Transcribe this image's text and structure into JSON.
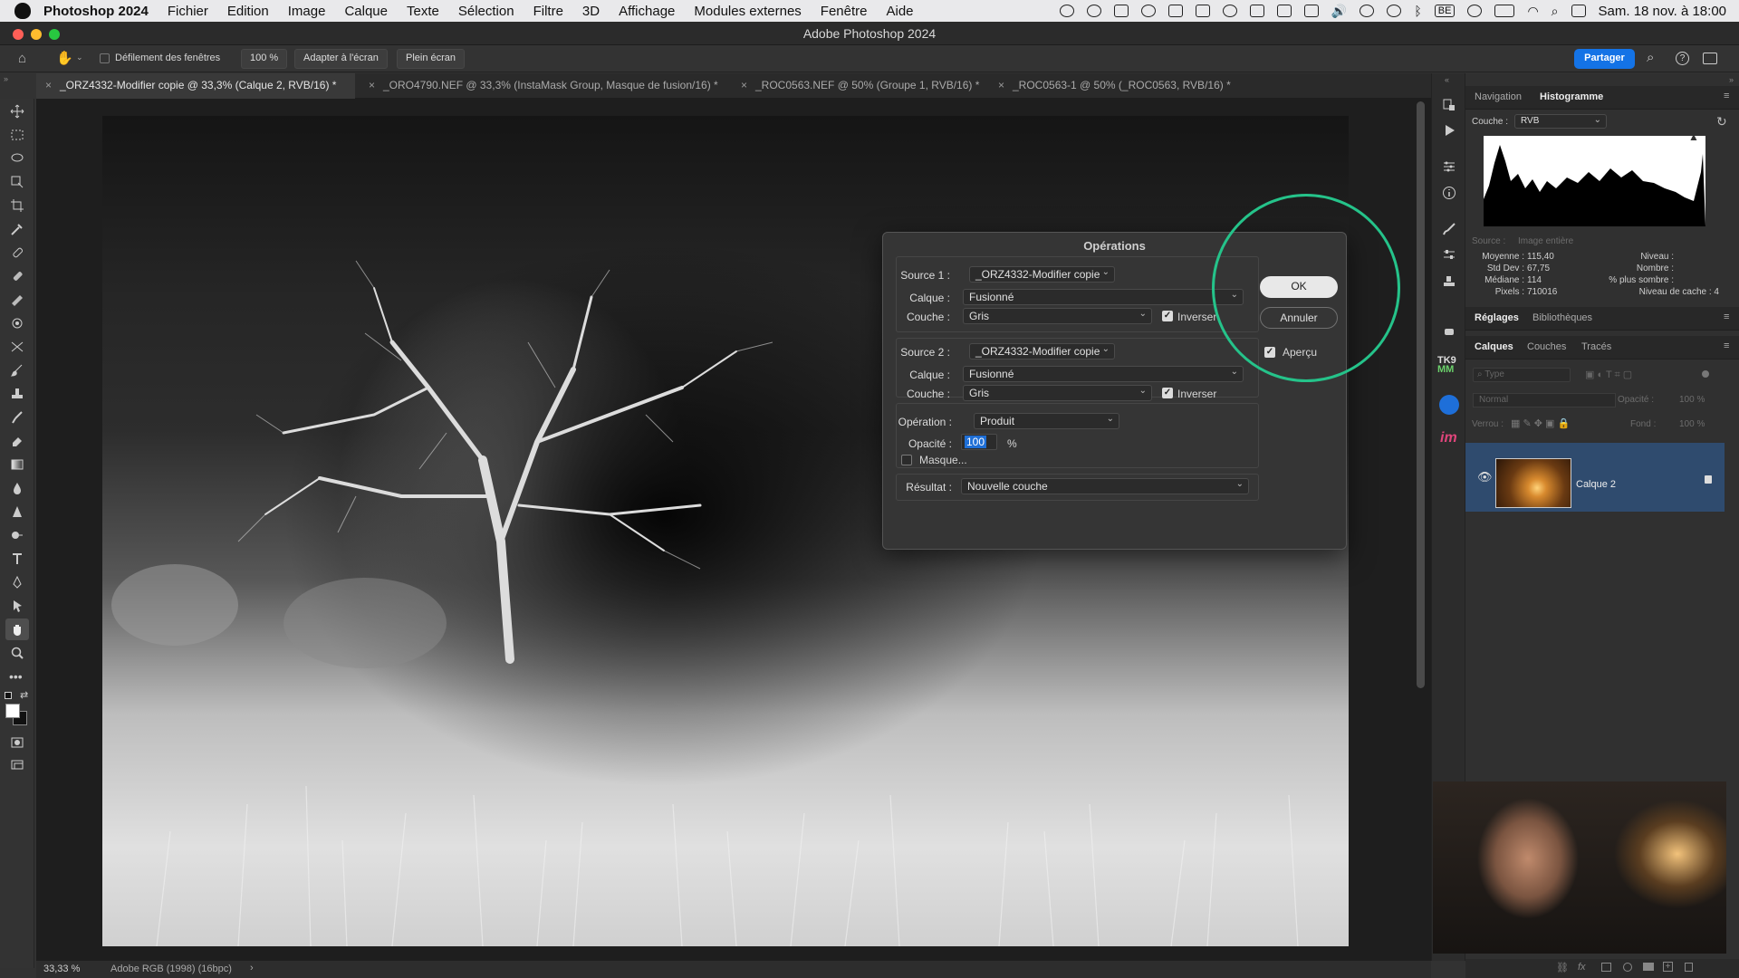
{
  "menubar": {
    "app": "Photoshop 2024",
    "items": [
      "Fichier",
      "Edition",
      "Image",
      "Calque",
      "Texte",
      "Sélection",
      "Filtre",
      "3D",
      "Affichage",
      "Modules externes",
      "Fenêtre",
      "Aide"
    ],
    "lang_badge": "BE",
    "datetime": "Sam. 18 nov. à 18:00"
  },
  "window": {
    "title": "Adobe Photoshop 2024"
  },
  "options": {
    "scroll_all_label": "Défilement des fenêtres",
    "zoom_value": "100 %",
    "fit_screen": "Adapter à l'écran",
    "full_screen": "Plein écran",
    "share": "Partager"
  },
  "tabs": [
    "_ORZ4332-Modifier copie @ 33,3% (Calque 2, RVB/16) *",
    "_ORO4790.NEF @ 33,3% (InstaMask Group, Masque de fusion/16) *",
    "_ROC0563.NEF @ 50% (Groupe 1, RVB/16) *",
    "_ROC0563-1 @ 50% (_ROC0563, RVB/16) *"
  ],
  "status": {
    "zoom": "33,33 %",
    "profile": "Adobe RGB (1998) (16bpc)"
  },
  "dialog": {
    "title": "Opérations",
    "source1": {
      "label": "Source 1 :",
      "value": "_ORZ4332-Modifier copie",
      "layer_label": "Calque :",
      "layer": "Fusionné",
      "channel_label": "Couche :",
      "channel": "Gris",
      "invert": "Inverser"
    },
    "source2": {
      "label": "Source 2 :",
      "value": "_ORZ4332-Modifier copie",
      "layer_label": "Calque :",
      "layer": "Fusionné",
      "channel_label": "Couche :",
      "channel": "Gris",
      "invert": "Inverser"
    },
    "operation_label": "Opération :",
    "operation": "Produit",
    "opacity_label": "Opacité :",
    "opacity": "100",
    "opacity_unit": "%",
    "mask": "Masque...",
    "result_label": "Résultat :",
    "result": "Nouvelle couche",
    "ok": "OK",
    "cancel": "Annuler",
    "preview": "Aperçu"
  },
  "panels": {
    "top_tabs": [
      "Navigation",
      "Histogramme"
    ],
    "channel_label": "Couche :",
    "channel_value": "RVB",
    "source_label": "Source :",
    "source_value": "Image entière",
    "stats_left": [
      [
        "Moyenne :",
        "115,40"
      ],
      [
        "Std Dev :",
        "67,75"
      ],
      [
        "Médiane :",
        "114"
      ],
      [
        "Pixels :",
        "710016"
      ]
    ],
    "stats_right": [
      "Niveau :",
      "Nombre :",
      "% plus sombre :",
      "Niveau de cache :  4"
    ],
    "mid_tabs": [
      "Réglages",
      "Bibliothèques"
    ],
    "layer_tabs": [
      "Calques",
      "Couches",
      "Tracés"
    ],
    "search_placeholder": "Type",
    "blend_mode": "Normal",
    "opacity_label": "Opacité :",
    "opacity_value": "100 %",
    "lock_label": "Verrou :",
    "fill_label": "Fond :",
    "fill_value": "100 %",
    "layer_name": "Calque 2"
  },
  "colors": {
    "accent": "#1473e6",
    "highlight_ring": "#25c38a",
    "layer_selected": "#2f4b6e"
  }
}
